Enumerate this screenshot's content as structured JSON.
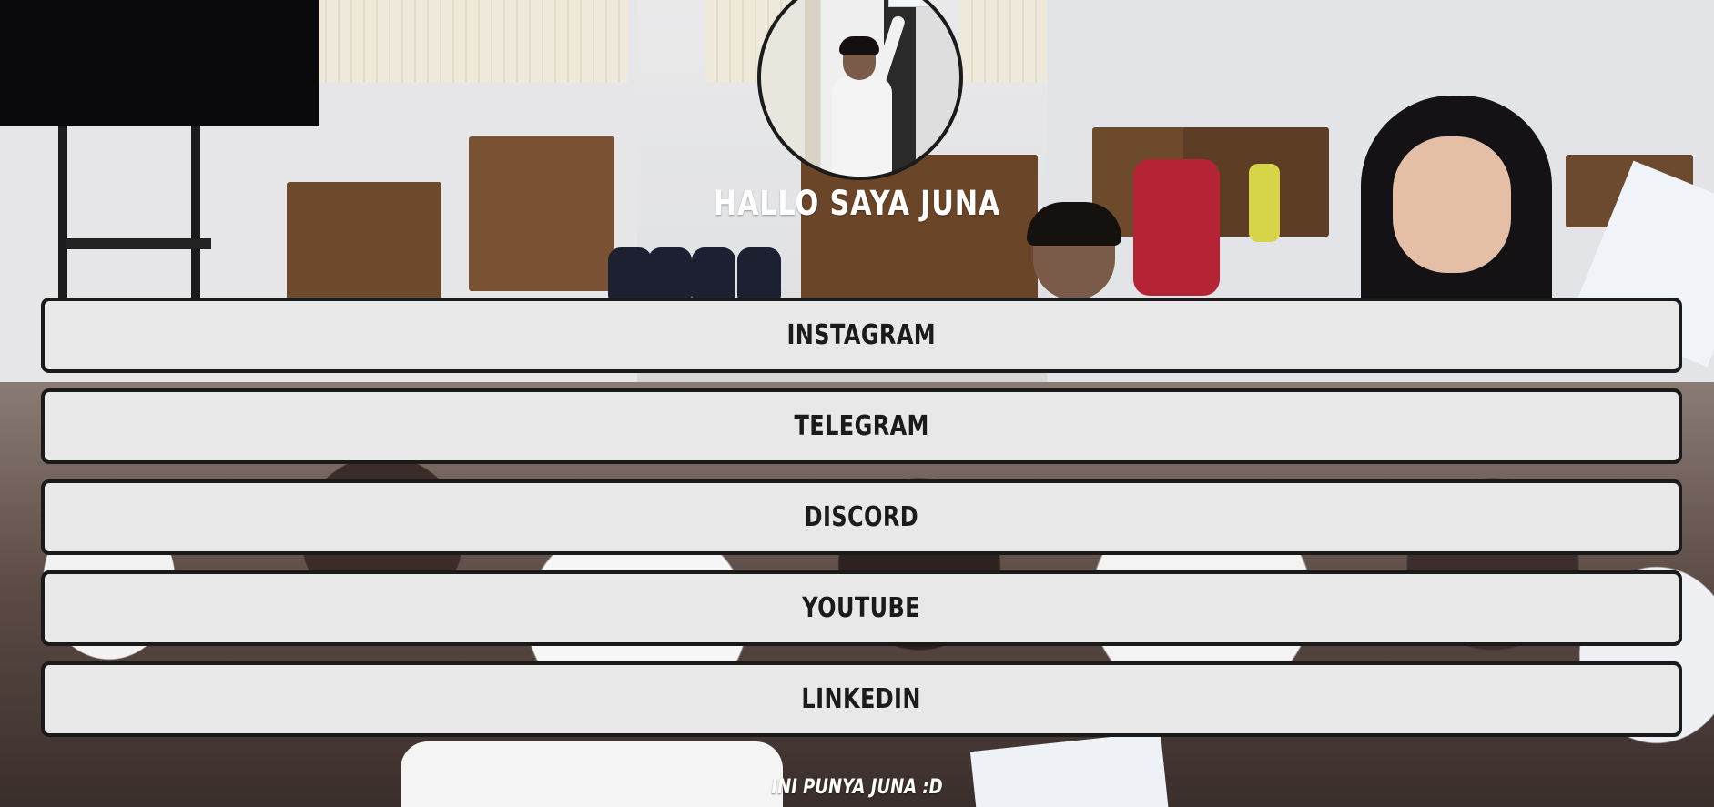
{
  "profile": {
    "greeting": "HALLO SAYA JUNA"
  },
  "links": [
    {
      "label": "INSTAGRAM"
    },
    {
      "label": "TELEGRAM"
    },
    {
      "label": "DISCORD"
    },
    {
      "label": "YOUTUBE"
    },
    {
      "label": "LINKEDIN"
    }
  ],
  "footer": {
    "text": "INI PUNYA JUNA :D"
  },
  "colors": {
    "button_bg": "#e8e8e8",
    "button_border": "#1a1a1a",
    "button_text": "#1b1b1b",
    "heading_text": "#ffffff"
  }
}
